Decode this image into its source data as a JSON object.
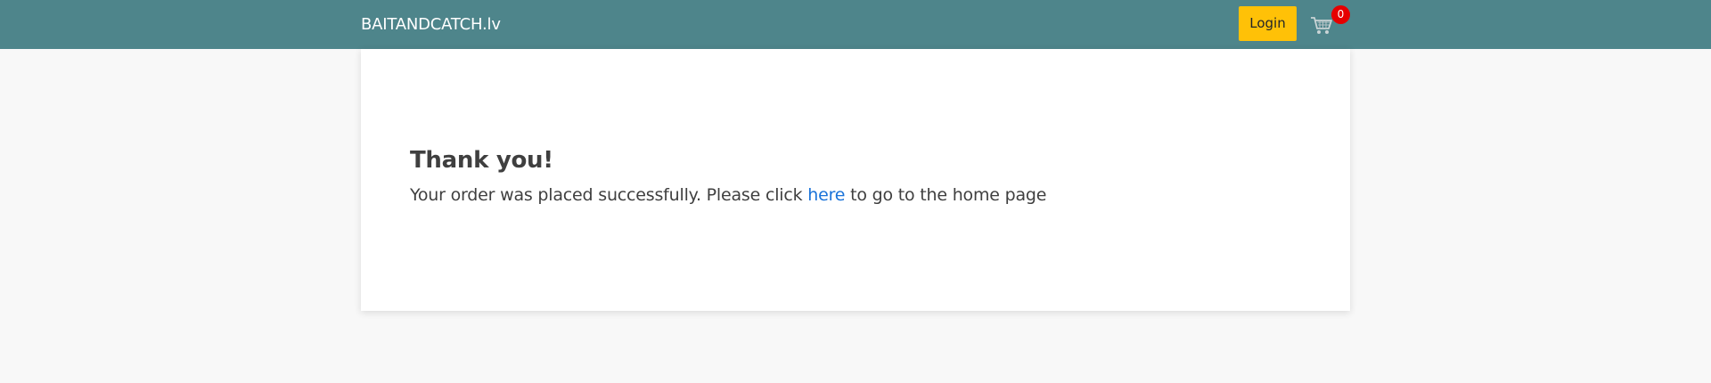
{
  "navbar": {
    "brand": "BAITANDCATCH.lv",
    "login_label": "Login",
    "cart_icon": "shopping-cart-icon",
    "cart_count": "0",
    "colors": {
      "background": "#4e858b",
      "login_button": "#ffc107",
      "badge": "#e60000"
    }
  },
  "confirmation": {
    "title": "Thank you!",
    "message_before": "Your order was placed successfully. Please click ",
    "link_text": "here",
    "message_after": " to go to the home page",
    "link_color": "#1a73d9"
  }
}
